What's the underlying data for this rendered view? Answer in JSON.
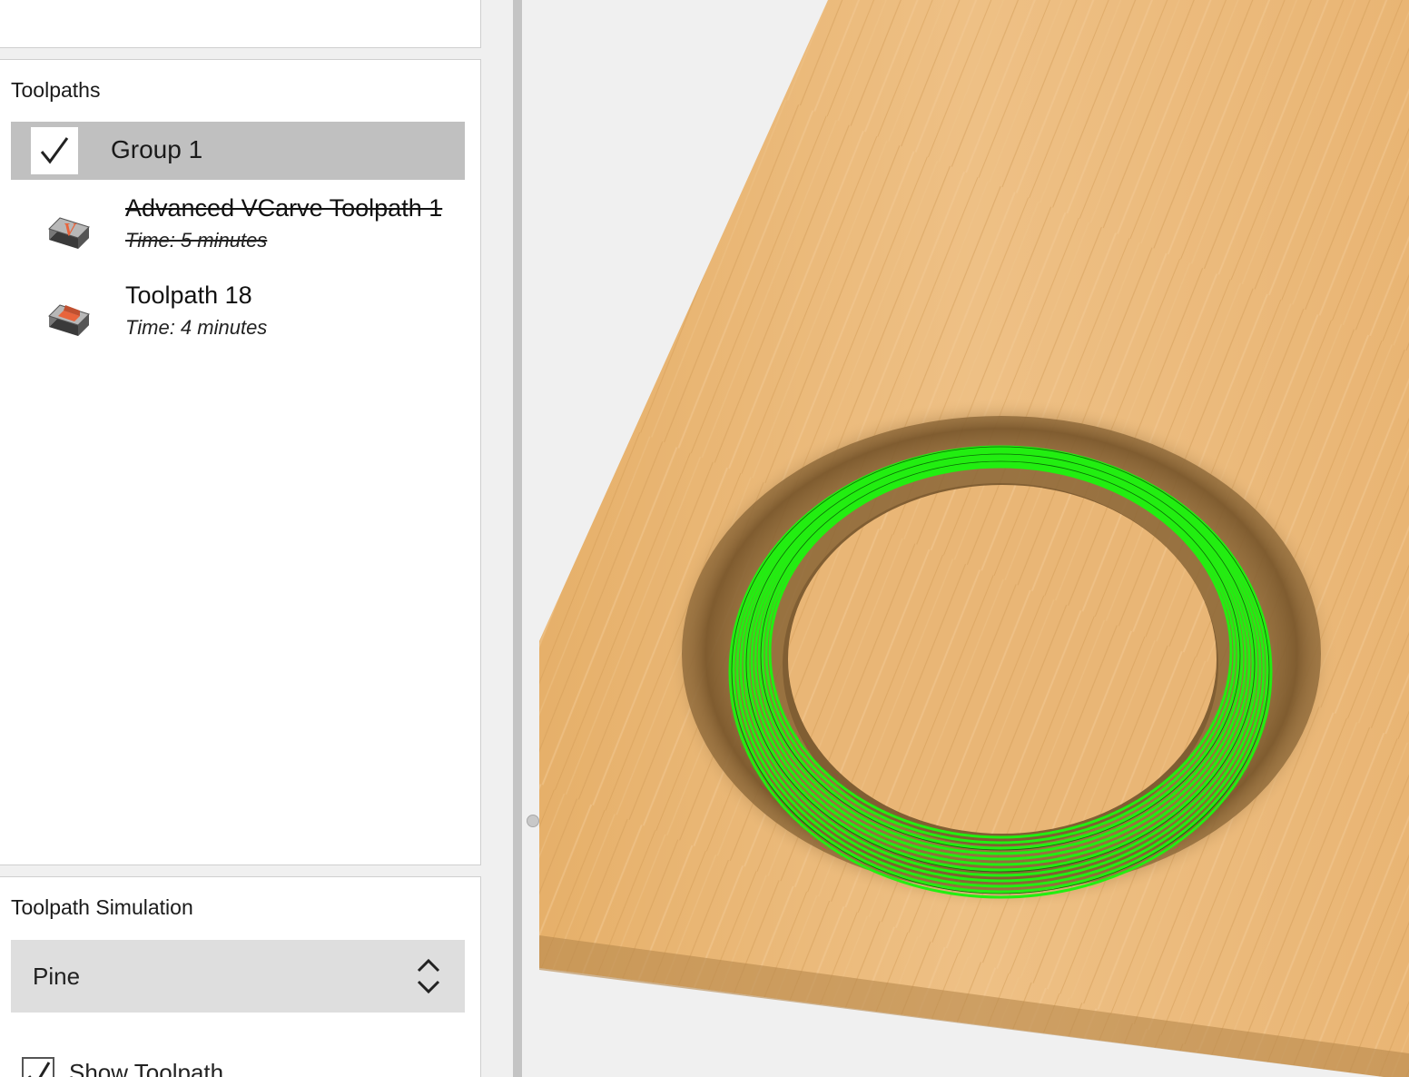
{
  "toolpaths_panel": {
    "title": "Toolpaths",
    "group": {
      "label": "Group 1",
      "checked": true
    },
    "items": [
      {
        "name": "Advanced VCarve Toolpath 1",
        "time": "Time: 5 minutes",
        "icon": "vcarve-icon",
        "disabled": true
      },
      {
        "name": "Toolpath 18",
        "time": "Time: 4 minutes",
        "icon": "pocket-icon",
        "disabled": false
      }
    ]
  },
  "simulation_panel": {
    "title": "Toolpath Simulation",
    "material": "Pine",
    "show_toolpath_label": "Show Toolpath",
    "show_toolpath_checked": true
  },
  "viewport": {
    "material_color": "#e8b878",
    "toolpath_color": "#22ee11"
  }
}
